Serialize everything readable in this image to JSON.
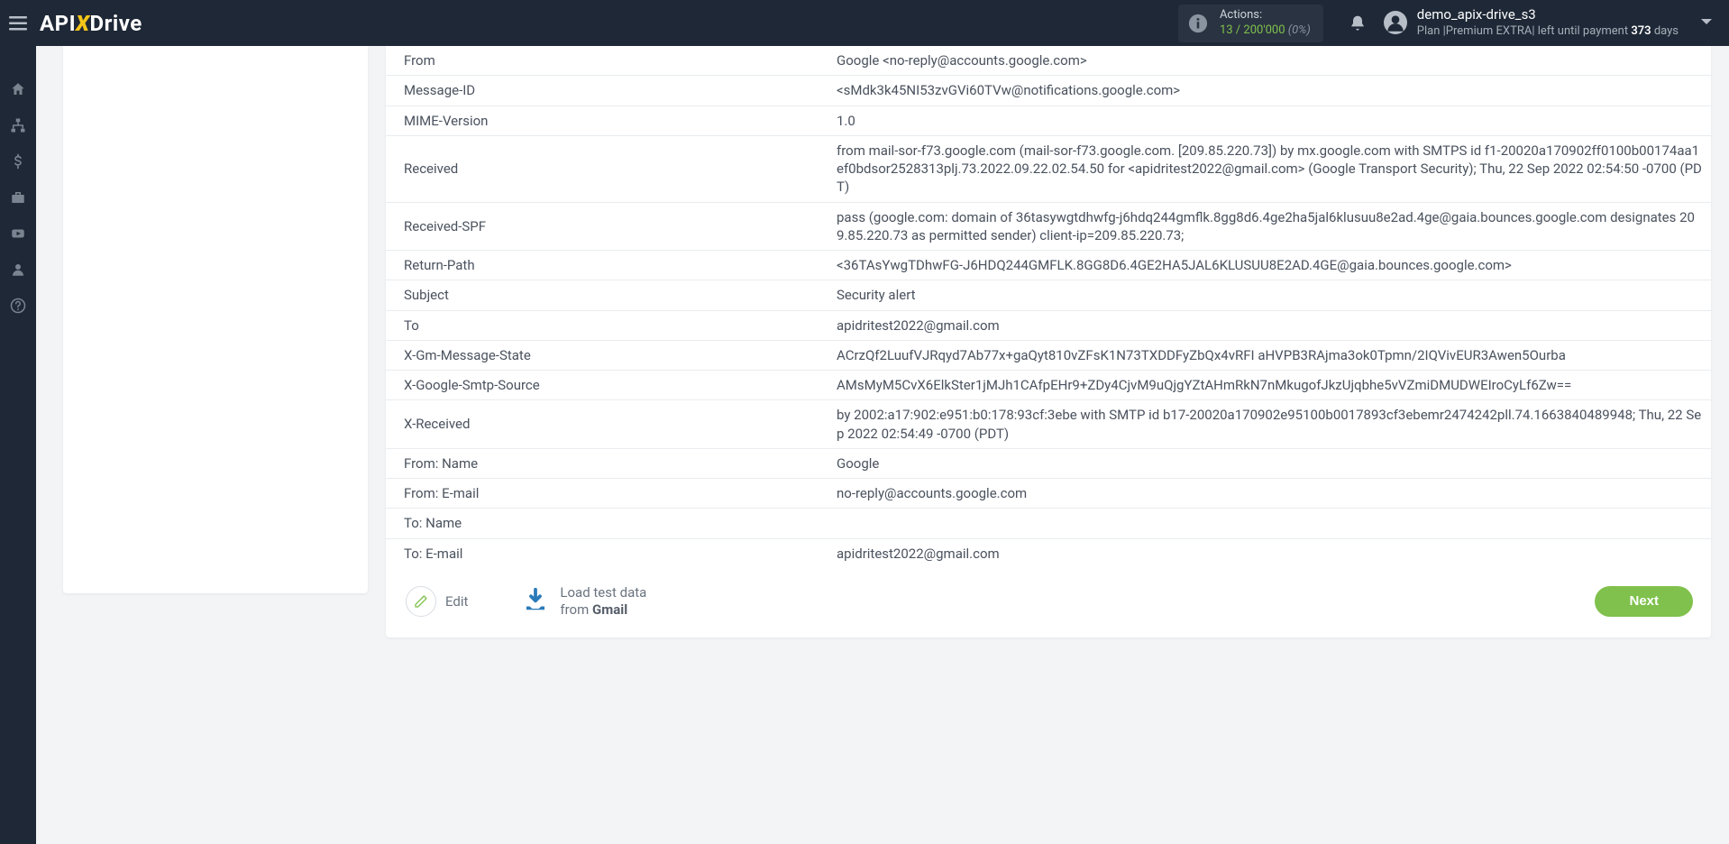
{
  "header": {
    "logo_text_1": "API",
    "logo_text_x": "X",
    "logo_text_2": "Drive",
    "actions_label": "Actions:",
    "actions_used": "13",
    "actions_slash": " / ",
    "actions_total": "200'000",
    "actions_pct": "(0%)",
    "user_name": "demo_apix-drive_s3",
    "plan_prefix": "Plan |",
    "plan_name": "Premium EXTRA",
    "plan_mid": "| left until payment ",
    "plan_days": "373",
    "plan_suffix": " days"
  },
  "table": {
    "rows": [
      {
        "k": "From",
        "v": "Google <no-reply@accounts.google.com>"
      },
      {
        "k": "Message-ID",
        "v": "<sMdk3k45NI53zvGVi60TVw@notifications.google.com>"
      },
      {
        "k": "MIME-Version",
        "v": "1.0"
      },
      {
        "k": "Received",
        "v": "from mail-sor-f73.google.com (mail-sor-f73.google.com. [209.85.220.73]) by mx.google.com with SMTPS id f1-20020a170902ff0100b00174aa1ef0bdsor2528313plj.73.2022.09.22.02.54.50 for <apidritest2022@gmail.com> (Google Transport Security); Thu, 22 Sep 2022 02:54:50 -0700 (PDT)"
      },
      {
        "k": "Received-SPF",
        "v": "pass (google.com: domain of 36tasywgtdhwfg-j6hdq244gmflk.8gg8d6.4ge2ha5jal6klusuu8e2ad.4ge@gaia.bounces.google.com designates 209.85.220.73 as permitted sender) client-ip=209.85.220.73;"
      },
      {
        "k": "Return-Path",
        "v": "<36TAsYwgTDhwFG-J6HDQ244GMFLK.8GG8D6.4GE2HA5JAL6KLUSUU8E2AD.4GE@gaia.bounces.google.com>"
      },
      {
        "k": "Subject",
        "v": "Security alert"
      },
      {
        "k": "To",
        "v": "apidritest2022@gmail.com"
      },
      {
        "k": "X-Gm-Message-State",
        "v": "ACrzQf2LuufVJRqyd7Ab77x+gaQyt810vZFsK1N73TXDDFyZbQx4vRFI aHVPB3RAjma3ok0Tpmn/2IQVivEUR3Awen5Ourba"
      },
      {
        "k": "X-Google-Smtp-Source",
        "v": "AMsMyM5CvX6ElkSter1jMJh1CAfpEHr9+ZDy4CjvM9uQjgYZtAHmRkN7nMkugofJkzUjqbhe5vVZmiDMUDWEIroCyLf6Zw=="
      },
      {
        "k": "X-Received",
        "v": "by 2002:a17:902:e951:b0:178:93cf:3ebe with SMTP id b17-20020a170902e95100b0017893cf3ebemr2474242pll.74.1663840489948; Thu, 22 Sep 2022 02:54:49 -0700 (PDT)"
      },
      {
        "k": "From: Name",
        "v": "Google"
      },
      {
        "k": "From: E-mail",
        "v": "no-reply@accounts.google.com"
      },
      {
        "k": "To: Name",
        "v": ""
      },
      {
        "k": "To: E-mail",
        "v": "apidritest2022@gmail.com"
      }
    ]
  },
  "footer": {
    "edit_label": "Edit",
    "load_line1": "Load test data",
    "load_line2_prefix": "from ",
    "load_line2_strong": "Gmail",
    "next_label": "Next"
  }
}
